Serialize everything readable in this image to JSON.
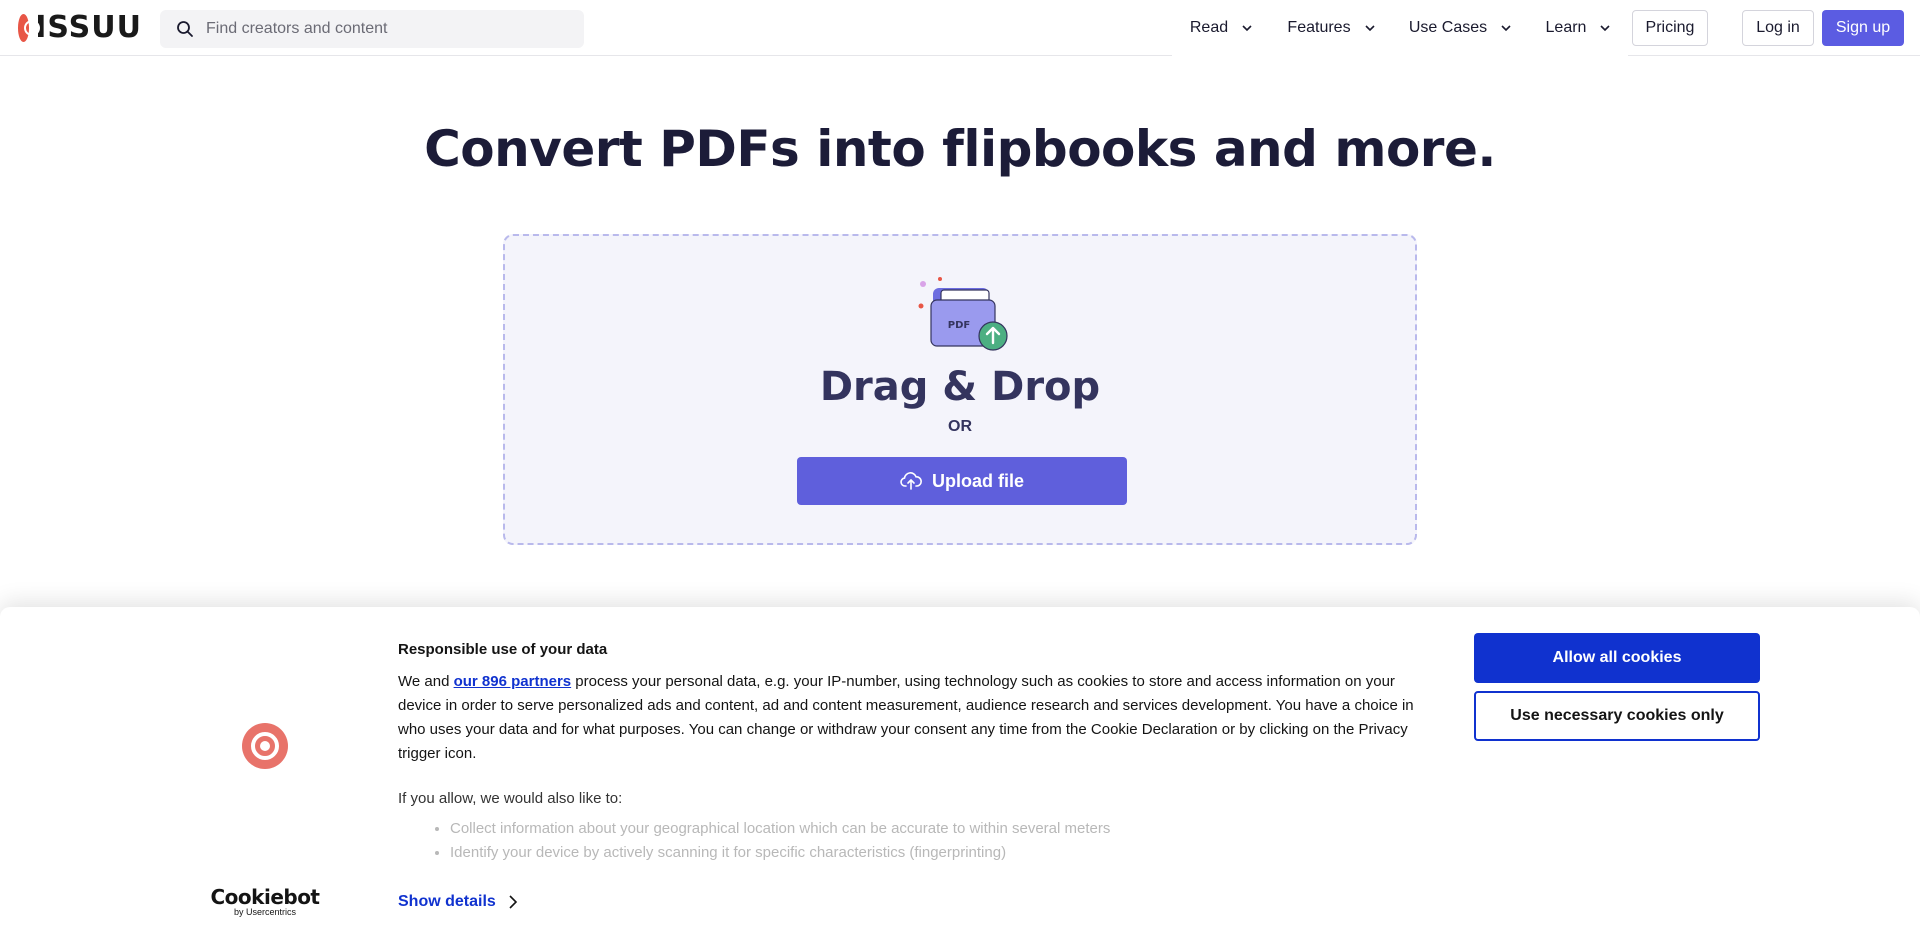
{
  "header": {
    "logo_text": "ISSUU",
    "search": {
      "placeholder": "Find creators and content",
      "value": ""
    },
    "nav": [
      {
        "label": "Read",
        "has_dropdown": true
      },
      {
        "label": "Features",
        "has_dropdown": true
      },
      {
        "label": "Use Cases",
        "has_dropdown": true
      },
      {
        "label": "Learn",
        "has_dropdown": true
      }
    ],
    "pricing_label": "Pricing",
    "login_label": "Log in",
    "signup_label": "Sign up"
  },
  "hero": {
    "title": "Convert PDFs into flipbooks and more.",
    "dropzone": {
      "pdf_badge": "PDF",
      "title": "Drag & Drop",
      "or_text": "OR",
      "upload_label": "Upload file"
    }
  },
  "cookie_banner": {
    "heading": "Responsible use of your data",
    "para_before_link": "We and ",
    "partners_link": "our 896 partners",
    "para_after_link": " process your personal data, e.g. your IP-number, using technology such as cookies to store and access information on your device in order to serve personalized ads and content, ad and content measurement, audience research and services development. You have a choice in who uses your data and for what purposes. You can change or withdraw your consent any time from the Cookie Declaration or by clicking on the Privacy trigger icon.",
    "allow_intro": "If you allow, we would also like to:",
    "allow_items": [
      "Collect information about your geographical location which can be accurate to within several meters",
      "Identify your device by actively scanning it for specific characteristics (fingerprinting)"
    ],
    "show_details_label": "Show details",
    "allow_all_label": "Allow all cookies",
    "necessary_only_label": "Use necessary cookies only",
    "cookiebot_logo": "Cookiebot",
    "cookiebot_sub": "by Usercentrics"
  },
  "colors": {
    "brand_red": "#e85646",
    "accent_purple": "#5b5ce2",
    "cookie_blue": "#1032cf",
    "upload_green": "#4caf82"
  }
}
